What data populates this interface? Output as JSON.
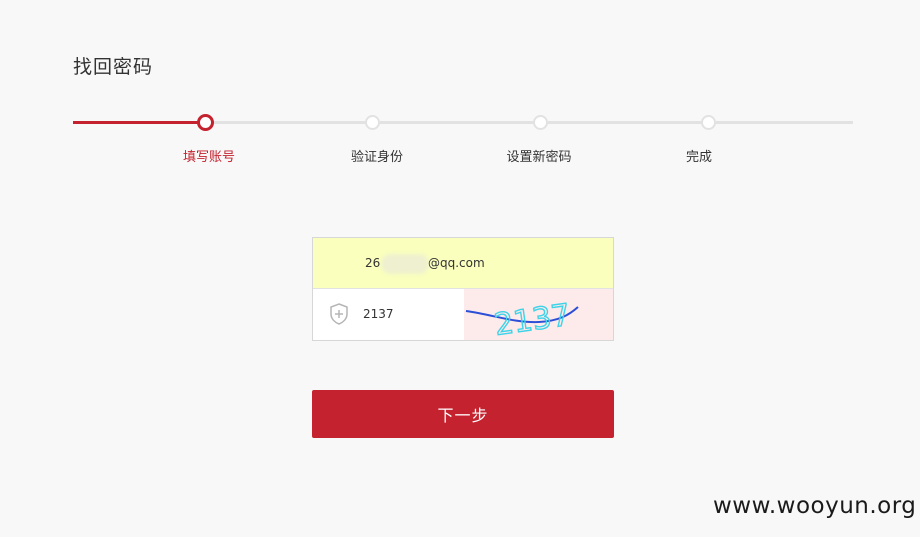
{
  "page": {
    "title": "找回密码"
  },
  "steps": [
    {
      "label": "填写账号",
      "state": "active"
    },
    {
      "label": "验证身份",
      "state": "pending"
    },
    {
      "label": "设置新密码",
      "state": "pending"
    },
    {
      "label": "完成",
      "state": "pending"
    }
  ],
  "progress": {
    "completed_fraction": 0.17
  },
  "form": {
    "email_prefix": "26",
    "email_suffix": "@qq.com",
    "captcha_value": "2137",
    "captcha_image_text": "2137",
    "shield_icon": "shield-plus-icon"
  },
  "buttons": {
    "next_label": "下一步"
  },
  "watermark": "www.wooyun.org",
  "colors": {
    "accent": "#c4222e",
    "autofill": "#faffbd",
    "captcha_bg": "#fdeaea"
  }
}
